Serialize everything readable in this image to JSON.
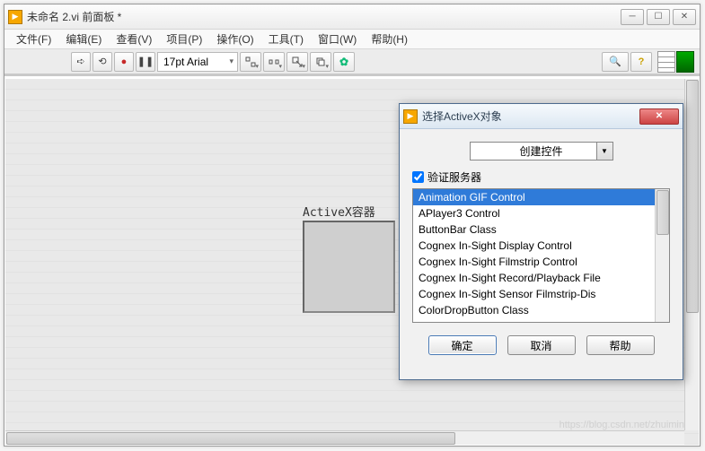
{
  "main": {
    "title": "未命名 2.vi 前面板 *",
    "menu": [
      "文件(F)",
      "编辑(E)",
      "查看(V)",
      "项目(P)",
      "操作(O)",
      "工具(T)",
      "窗口(W)",
      "帮助(H)"
    ],
    "font_label": "17pt Arial",
    "activex_label": "ActiveX容器"
  },
  "dialog": {
    "title": "选择ActiveX对象",
    "dropdown": "创建控件",
    "checkbox_label": "验证服务器",
    "list": [
      "Animation GIF Control",
      "APlayer3 Control",
      "ButtonBar Class",
      "Cognex  In-Sight Display Control",
      "Cognex  In-Sight Filmstrip Control",
      "Cognex  In-Sight Record/Playback File",
      "Cognex  In-Sight Sensor Filmstrip-Dis",
      "ColorDropButton Class"
    ],
    "ok": "确定",
    "cancel": "取消",
    "help": "帮助"
  },
  "watermark": "https://blog.csdn.net/zhuimin"
}
